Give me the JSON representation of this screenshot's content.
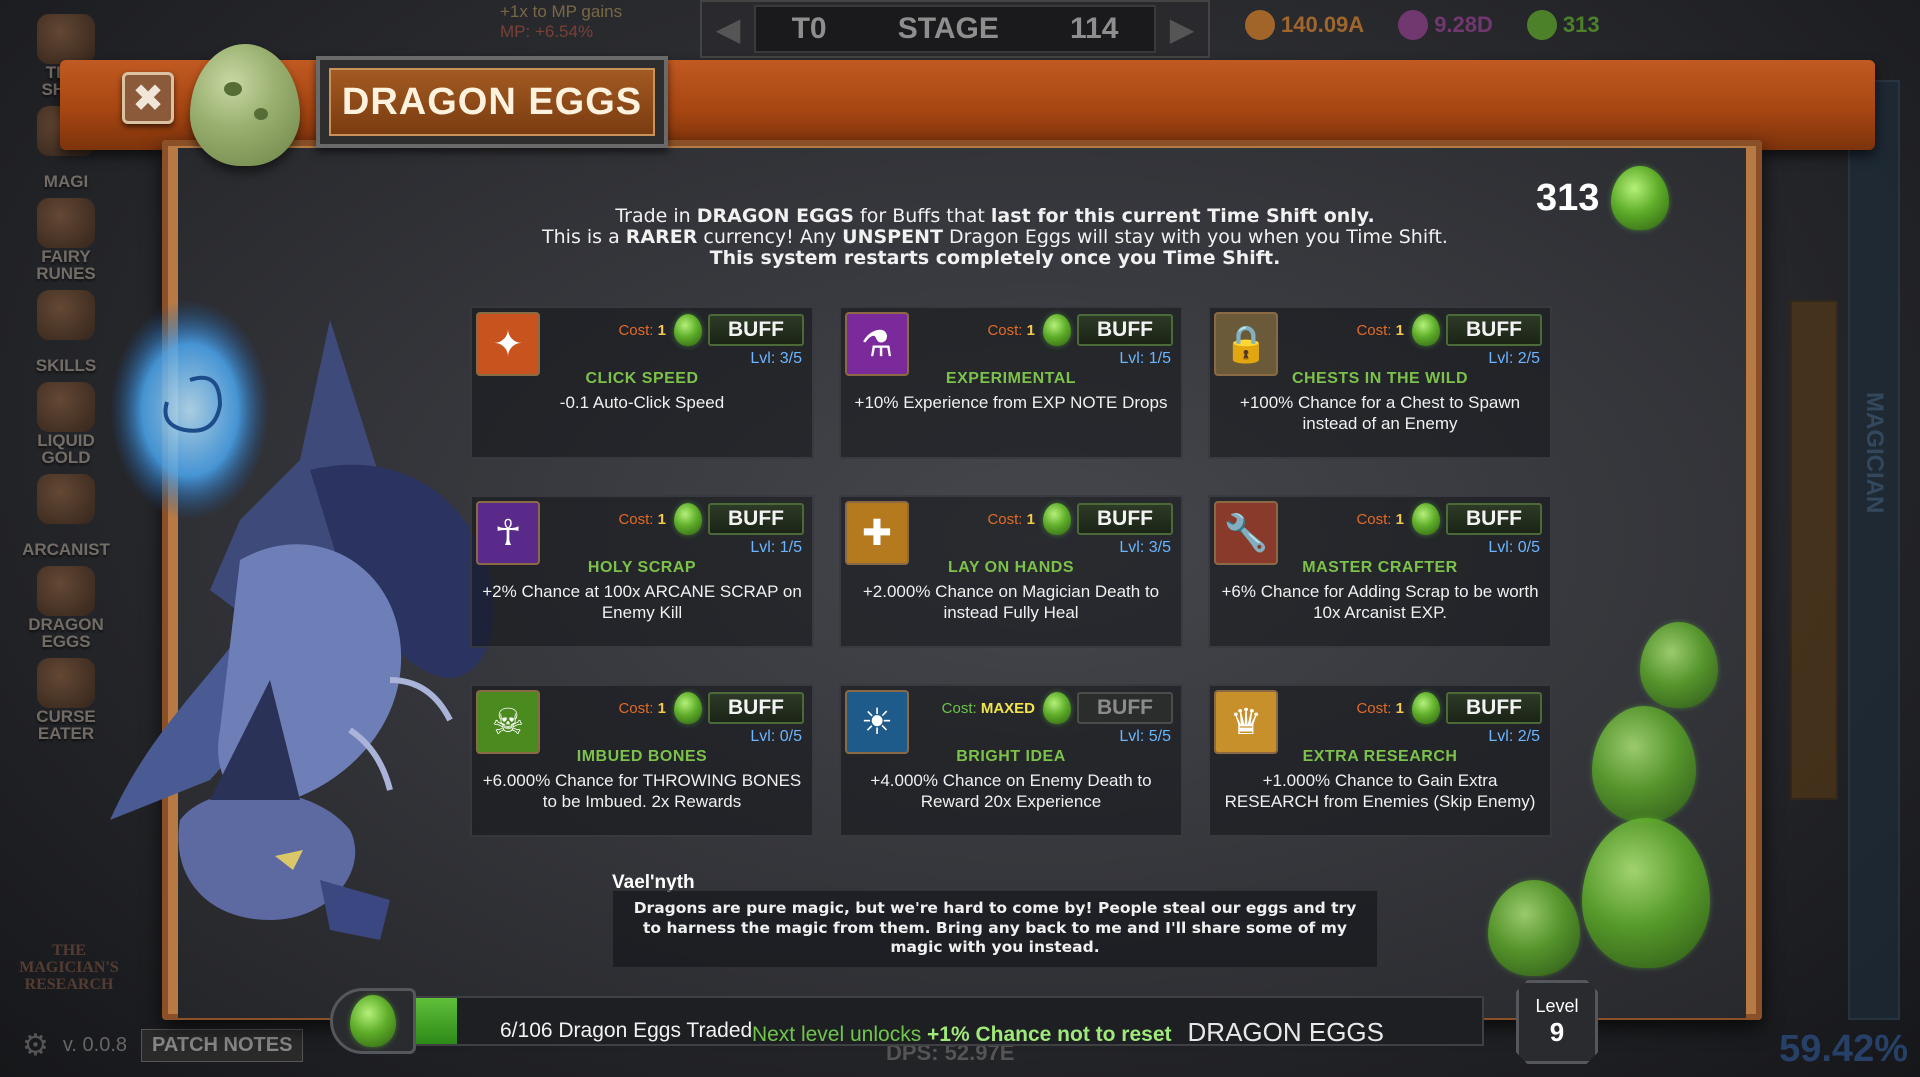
{
  "background": {
    "left_nav": [
      {
        "label": "TIME\nSHIFT"
      },
      {
        "label": "MAGI"
      },
      {
        "label": "FAIRY\nRUNES"
      },
      {
        "label": "SKILLS"
      },
      {
        "label": "LIQUID\nGOLD"
      },
      {
        "label": "ARCANIST"
      },
      {
        "label": "DRAGON\nEGGS"
      },
      {
        "label": "CURSE\nEATER"
      }
    ],
    "mp_bonus_line1": "+1x to MP gains",
    "mp_bonus_line2": "MP: +6.54%",
    "stage_prefix": "T0",
    "stage_label": "STAGE",
    "stage_value": "114",
    "currencies": [
      {
        "icon": "gold-chest-icon",
        "value": "140.09A",
        "color": "#c97a2a"
      },
      {
        "icon": "purple-gem-icon",
        "value": "9.28D",
        "color": "#8a3d86"
      },
      {
        "icon": "dragon-egg-icon",
        "value": "313",
        "color": "#5aa02a"
      }
    ],
    "right_rail_label": "MAGICIAN",
    "percent_readout": "59.42%",
    "version": "v. 0.0.8",
    "patch_notes": "PATCH NOTES",
    "brand": "THE\nMAGICIAN'S\nRESEARCH",
    "dps": "DPS: 52.97E"
  },
  "modal": {
    "title": "DRAGON EGGS",
    "close_icon": "close-icon",
    "egg_count": "313",
    "intro": {
      "l1_a": "Trade in ",
      "l1_b": "DRAGON EGGS",
      "l1_c": " for Buffs that ",
      "l1_d": "last for this current Time Shift only.",
      "l2_a": "This is a ",
      "l2_b": "RARER",
      "l2_c": " currency! Any ",
      "l2_d": "UNSPENT",
      "l2_e": " Dragon Eggs will stay with you when you Time Shift.",
      "l3": "This system restarts completely once you Time Shift."
    },
    "buffs": [
      {
        "icon": "click-speed-icon",
        "glyph": "✦",
        "icon_bg": "#c8531e",
        "cost_label": "Cost:",
        "cost": "1",
        "button": "BUFF",
        "enabled": true,
        "lvl_label": "Lvl:",
        "lvl": "3/5",
        "name": "CLICK SPEED",
        "desc": "-0.1 Auto-Click Speed"
      },
      {
        "icon": "experimental-icon",
        "glyph": "⚗",
        "icon_bg": "#7a2a9a",
        "cost_label": "Cost:",
        "cost": "1",
        "button": "BUFF",
        "enabled": true,
        "lvl_label": "Lvl:",
        "lvl": "1/5",
        "name": "EXPERIMENTAL",
        "desc": "+10% Experience from EXP NOTE Drops"
      },
      {
        "icon": "chest-lock-icon",
        "glyph": "🔒",
        "icon_bg": "#6a5a3a",
        "cost_label": "Cost:",
        "cost": "1",
        "button": "BUFF",
        "enabled": true,
        "lvl_label": "Lvl:",
        "lvl": "2/5",
        "name": "CHESTS IN THE WILD",
        "desc": "+100% Chance for a Chest to Spawn instead of an Enemy"
      },
      {
        "icon": "holy-scrap-icon",
        "glyph": "☥",
        "icon_bg": "#5a2a8a",
        "cost_label": "Cost:",
        "cost": "1",
        "button": "BUFF",
        "enabled": true,
        "lvl_label": "Lvl:",
        "lvl": "1/5",
        "name": "HOLY SCRAP",
        "desc": "+2% Chance at 100x ARCANE SCRAP on Enemy Kill"
      },
      {
        "icon": "lay-on-hands-icon",
        "glyph": "✚",
        "icon_bg": "#b57a1e",
        "cost_label": "Cost:",
        "cost": "1",
        "button": "BUFF",
        "enabled": true,
        "lvl_label": "Lvl:",
        "lvl": "3/5",
        "name": "LAY ON HANDS",
        "desc": "+2.000% Chance on Magician Death to instead Fully Heal"
      },
      {
        "icon": "master-crafter-icon",
        "glyph": "🔧",
        "icon_bg": "#8a3a2a",
        "cost_label": "Cost:",
        "cost": "1",
        "button": "BUFF",
        "enabled": true,
        "lvl_label": "Lvl:",
        "lvl": "0/5",
        "name": "MASTER CRAFTER",
        "desc": "+6% Chance for Adding Scrap to be worth 10x Arcanist EXP."
      },
      {
        "icon": "imbued-bones-icon",
        "glyph": "☠",
        "icon_bg": "#4a8a1e",
        "cost_label": "Cost:",
        "cost": "1",
        "button": "BUFF",
        "enabled": true,
        "lvl_label": "Lvl:",
        "lvl": "0/5",
        "name": "IMBUED BONES",
        "desc": "+6.000% Chance for THROWING BONES to be Imbued. 2x Rewards"
      },
      {
        "icon": "bright-idea-icon",
        "glyph": "☀",
        "icon_bg": "#1e5a8a",
        "cost_label": "Cost:",
        "cost": "MAXED",
        "button": "BUFF",
        "enabled": false,
        "lvl_label": "Lvl:",
        "lvl": "5/5",
        "name": "BRIGHT IDEA",
        "desc": "+4.000% Chance on Enemy Death to Reward 20x Experience"
      },
      {
        "icon": "extra-research-icon",
        "glyph": "♛",
        "icon_bg": "#c8902a",
        "cost_label": "Cost:",
        "cost": "1",
        "button": "BUFF",
        "enabled": true,
        "lvl_label": "Lvl:",
        "lvl": "2/5",
        "name": "EXTRA RESEARCH",
        "desc": "+1.000% Chance to Gain Extra RESEARCH from Enemies (Skip Enemy)"
      }
    ],
    "npc": {
      "name": "Vael'nyth",
      "text": "Dragons are pure magic, but we're hard to come by! People steal our eggs and try to harness the magic from them. Bring any back to me and I'll share some of my magic with you instead."
    },
    "progress": {
      "traded": 6,
      "total": 106,
      "text": "6/106 Dragon Eggs Traded",
      "next_prefix": "Next level unlocks ",
      "next_highlight": "+1% Chance not to reset",
      "label": "DRAGON EGGS",
      "level_label": "Level",
      "level_value": "9"
    }
  }
}
